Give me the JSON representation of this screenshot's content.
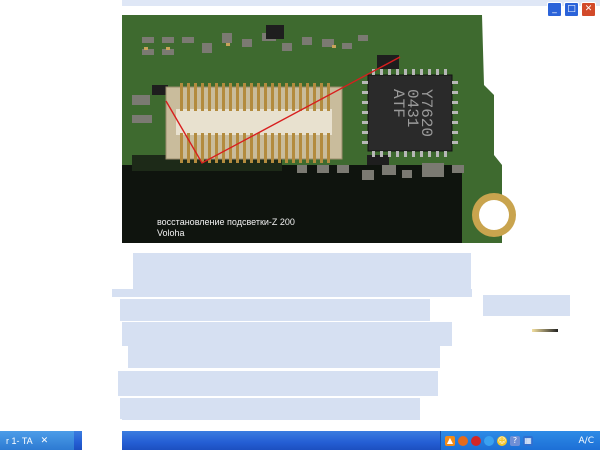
{
  "window": {
    "controls": [
      {
        "name": "minimize-button",
        "glyph": "_"
      },
      {
        "name": "maximize-button",
        "glyph": "□"
      },
      {
        "name": "close-button",
        "glyph": "✕"
      }
    ]
  },
  "photo": {
    "caption_line1": "восстановление подсветки-Z 200",
    "caption_line2": "Voloha",
    "chip_text_line1": "Y7620",
    "chip_text_line2": "0431",
    "chip_text_line3": "ATF"
  },
  "taskbar": {
    "active_task_label": "r 1- TA",
    "close_glyph": "✕",
    "tray_icons": [
      "orange-cone-icon",
      "firefox-icon",
      "red-circle-icon",
      "blue-globe-icon",
      "smiley-icon",
      "help-icon",
      "network-icon"
    ],
    "clock": "A/C"
  }
}
